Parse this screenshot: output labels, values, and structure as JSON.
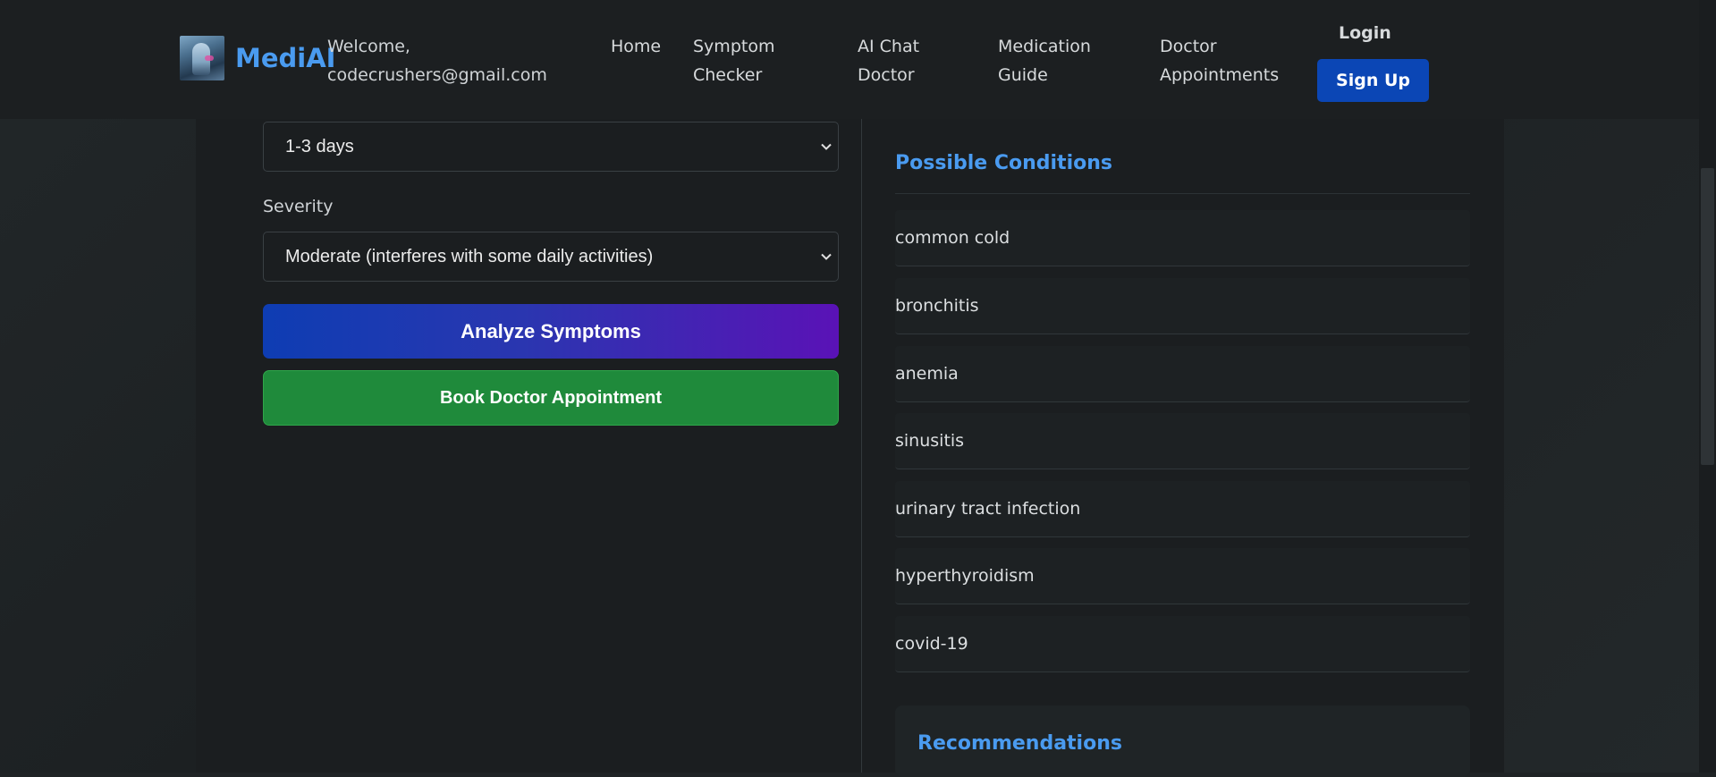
{
  "header": {
    "brand": "MediAI",
    "welcome_line1": "Welcome,",
    "welcome_line2": "codecrushers@gmail.com",
    "nav": [
      {
        "line1": "Home",
        "line2": ""
      },
      {
        "line1": "Symptom",
        "line2": "Checker"
      },
      {
        "line1": "AI Chat",
        "line2": "Doctor"
      },
      {
        "line1": "Medication",
        "line2": "Guide"
      },
      {
        "line1": "Doctor",
        "line2": "Appointments"
      }
    ],
    "login_label": "Login",
    "signup_label": "Sign Up"
  },
  "form": {
    "duration_value": "1-3 days",
    "severity_label": "Severity",
    "severity_value": "Moderate (interferes with some daily activities)",
    "analyze_label": "Analyze Symptoms",
    "book_label": "Book Doctor Appointment"
  },
  "results": {
    "conditions_title": "Possible Conditions",
    "conditions": [
      "common cold",
      "bronchitis",
      "anemia",
      "sinusitis",
      "urinary tract infection",
      "hyperthyroidism",
      "covid-19"
    ],
    "recommendations_title": "Recommendations"
  },
  "colors": {
    "accent_blue": "#4a9bf0",
    "signup_bg": "#0b46b5",
    "book_green": "#1f8a3b",
    "analyze_gradient_start": "#0e3db3",
    "analyze_gradient_end": "#5a12b6"
  }
}
